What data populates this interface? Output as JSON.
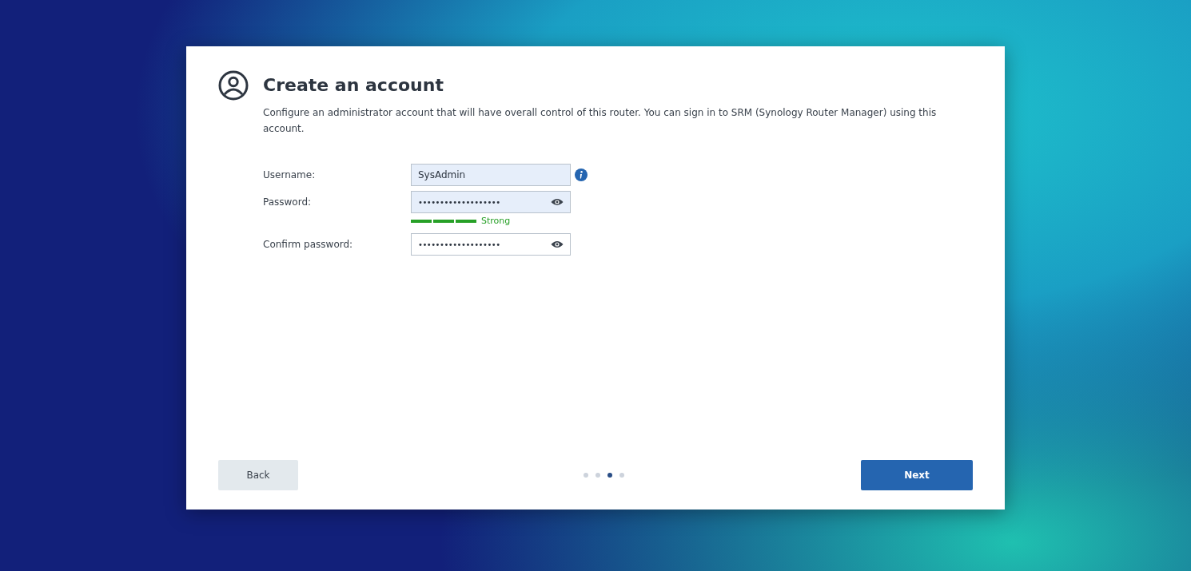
{
  "dialog": {
    "title": "Create an account",
    "description": "Configure an administrator account that will have overall control of this router. You can sign in to SRM (Synology Router Manager) using this account.",
    "fields": [
      {
        "label": "Username:",
        "kind": "text",
        "value": "SysAdmin",
        "highlighted": true,
        "info": true
      },
      {
        "label": "Password:",
        "kind": "password",
        "value": "•••••••••••••••••••",
        "highlighted": true,
        "info": false,
        "strength": {
          "label": "Strong",
          "level": 1
        }
      },
      {
        "label": "Confirm password:",
        "kind": "password",
        "value": "•••••••••••••••••••",
        "highlighted": false,
        "info": false
      }
    ],
    "steps": [
      {
        "selected": false
      },
      {
        "selected": false
      },
      {
        "selected": true
      },
      {
        "selected": false
      }
    ],
    "buttons": {
      "back": "Back",
      "next": "Next"
    }
  }
}
